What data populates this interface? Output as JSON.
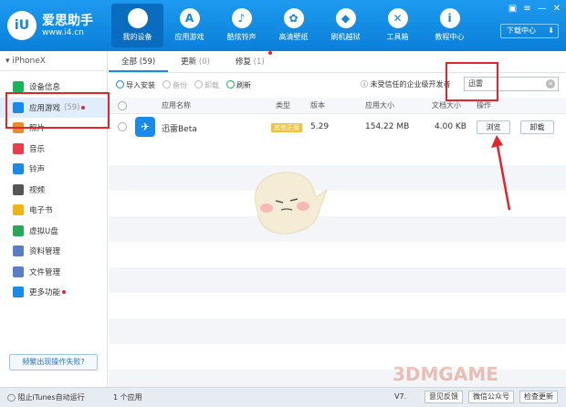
{
  "app": {
    "logo_text": "爱思助手",
    "logo_url": "www.i4.cn",
    "logo_mark": "iU"
  },
  "nav": [
    {
      "label": "我的设备",
      "icon": "apple-icon",
      "glyph": ""
    },
    {
      "label": "应用游戏",
      "icon": "appstore-icon",
      "glyph": "A"
    },
    {
      "label": "酷炫铃声",
      "icon": "bell-icon",
      "glyph": "♪"
    },
    {
      "label": "高清壁纸",
      "icon": "flower-icon",
      "glyph": "✿"
    },
    {
      "label": "刷机越狱",
      "icon": "box-icon",
      "glyph": "◆"
    },
    {
      "label": "工具箱",
      "icon": "tools-icon",
      "glyph": "✕"
    },
    {
      "label": "教程中心",
      "icon": "info-icon",
      "glyph": "i"
    }
  ],
  "download_label": "下载中心",
  "device_name": "iPhoneX",
  "sidebar": [
    {
      "label": "设备信息",
      "icon": "info-icon",
      "color": "#1cb15a"
    },
    {
      "label": "应用游戏",
      "icon": "appstore-icon",
      "color": "#1a8ae8",
      "badge": "(59)"
    },
    {
      "label": "照片",
      "icon": "photo-icon",
      "color": "#e98c2c"
    },
    {
      "label": "音乐",
      "icon": "music-icon",
      "color": "#ea3d4a"
    },
    {
      "label": "铃声",
      "icon": "bell-icon",
      "color": "#1a8ae8"
    },
    {
      "label": "视频",
      "icon": "video-icon",
      "color": "#555"
    },
    {
      "label": "电子书",
      "icon": "book-icon",
      "color": "#f1b417"
    },
    {
      "label": "虚拟U盘",
      "icon": "usb-icon",
      "color": "#2aa65a"
    },
    {
      "label": "资料管理",
      "icon": "contacts-icon",
      "color": "#5a7dc8"
    },
    {
      "label": "文件管理",
      "icon": "folder-icon",
      "color": "#5a7dc8"
    },
    {
      "label": "更多功能",
      "icon": "more-icon",
      "color": "#1a8ae8"
    }
  ],
  "help_label": "频繁出现操作失败?",
  "tabs": [
    {
      "label": "全部",
      "count": "(59)"
    },
    {
      "label": "更新",
      "count": "(0)"
    },
    {
      "label": "修复",
      "count": "(1)"
    }
  ],
  "toolbar": {
    "import": "导入安装",
    "backup": "备份",
    "uninstall": "卸载",
    "refresh": "刷新",
    "trust": "未受信任的企业级开发者"
  },
  "search": {
    "value": "迅雷"
  },
  "table": {
    "headers": {
      "name": "应用名称",
      "type": "类型",
      "version": "版本",
      "size": "应用大小",
      "docsize": "文档大小",
      "action": "操作"
    },
    "rows": [
      {
        "name": "迅雷Beta",
        "type": "其他正版",
        "version": "5.29",
        "size": "154.22 MB",
        "docsize": "4.00 KB",
        "browse": "浏览",
        "uninstall": "卸载"
      }
    ]
  },
  "bottom": {
    "itunes": "阻止iTunes自动运行",
    "count": "1 个应用",
    "version": "V7.",
    "b1": "意见反馈",
    "b2": "微信公众号",
    "b3": "检查更新"
  },
  "watermark": "3DMGAME",
  "colors": {
    "accent": "#1a8ae8",
    "highlight": "#e0252b",
    "badge": "#f0c33a"
  }
}
